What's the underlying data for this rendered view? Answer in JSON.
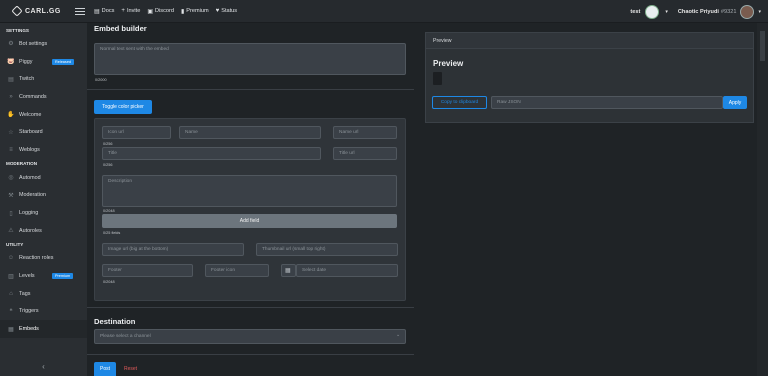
{
  "topbar": {
    "logo": "CARL.GG",
    "nav": [
      {
        "icon": "doc-icon",
        "label": "Docs"
      },
      {
        "icon": "plus-icon",
        "label": "Invite"
      },
      {
        "icon": "discord-icon",
        "label": "Discord"
      },
      {
        "icon": "patreon-icon",
        "label": "Premium"
      },
      {
        "icon": "heart-icon",
        "label": "Status"
      }
    ],
    "server_name": "test",
    "username": "Chaotic Priyudi",
    "discriminator": "#9321"
  },
  "sidebar": {
    "sections": [
      {
        "title": "SETTINGS",
        "items": [
          {
            "icon": "gear-icon",
            "glyph": "⚙",
            "label": "Bot settings"
          },
          {
            "icon": "piggy-icon",
            "glyph": "🐷",
            "label": "Piggy",
            "badge": "Released"
          },
          {
            "icon": "twitch-icon",
            "glyph": "▤",
            "label": "Twitch"
          },
          {
            "icon": "terminal-icon",
            "glyph": "»",
            "label": "Commands"
          },
          {
            "icon": "hand-icon",
            "glyph": "✋",
            "label": "Welcome"
          },
          {
            "icon": "star-icon",
            "glyph": "☆",
            "label": "Starboard"
          },
          {
            "icon": "log-icon",
            "glyph": "≡",
            "label": "Weblogs"
          }
        ]
      },
      {
        "title": "MODERATION",
        "items": [
          {
            "icon": "automod-icon",
            "glyph": "◎",
            "label": "Automod"
          },
          {
            "icon": "hammer-icon",
            "glyph": "⚒",
            "label": "Moderation"
          },
          {
            "icon": "file-icon",
            "glyph": "▯",
            "label": "Logging"
          },
          {
            "icon": "roles-icon",
            "glyph": "⚠",
            "label": "Autoroles"
          }
        ]
      },
      {
        "title": "UTILITY",
        "items": [
          {
            "icon": "reaction-icon",
            "glyph": "☺",
            "label": "Reaction roles"
          },
          {
            "icon": "chart-icon",
            "glyph": "▥",
            "label": "Levels",
            "badge": "Premium"
          },
          {
            "icon": "tag-icon",
            "glyph": "⌂",
            "label": "Tags"
          },
          {
            "icon": "trigger-icon",
            "glyph": "❝",
            "label": "Triggers"
          },
          {
            "icon": "embed-icon",
            "glyph": "▦",
            "label": "Embeds",
            "active": true
          }
        ]
      }
    ],
    "collapse_glyph": "‹"
  },
  "embed": {
    "title": "Embed builder",
    "content_placeholder": "Normal text sent with the embed",
    "content_count": "0/2000",
    "toggle_color": "Toggle color picker",
    "icon_url": "Icon url",
    "name": "Name",
    "name_url": "Name url",
    "name_count": "0/256",
    "title_field": "Title",
    "title_url": "Title url",
    "title_count": "0/256",
    "description": "Description",
    "description_count": "0/2048",
    "add_field": "Add field",
    "fields_count": "0/25 fields",
    "image_url": "Image url (big at the bottom)",
    "thumbnail_url": "Thumbnail url (small top right)",
    "footer": "Footer",
    "footer_icon": "Footer icon",
    "select_date": "Select date",
    "footer_count": "0/2048"
  },
  "destination": {
    "title": "Destination",
    "placeholder": "Please select a channel"
  },
  "actions": {
    "post": "Post",
    "reset": "Reset"
  },
  "preview": {
    "header": "Preview",
    "title": "Preview",
    "copy": "Copy to clipboard",
    "raw_placeholder": "Raw JSON",
    "apply": "Apply"
  },
  "colors": {
    "accent": "#1e88e5",
    "danger": "#e05a5a"
  }
}
